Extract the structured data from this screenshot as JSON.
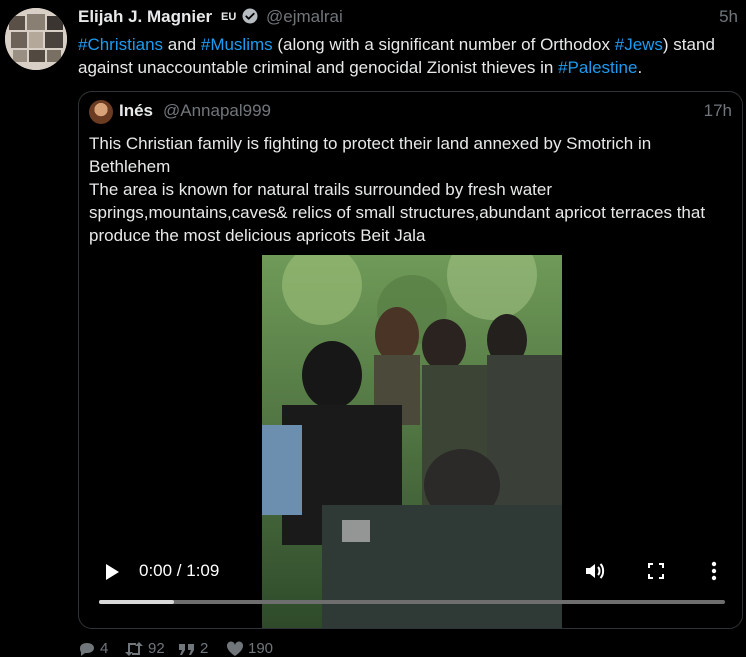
{
  "author": {
    "name": "Elijah J. Magnier",
    "badge": "EU",
    "handle": "@ejmalrai",
    "time": "5h"
  },
  "tweet": {
    "parts": [
      {
        "text": "#Christians",
        "hashtag": true
      },
      {
        "text": " and ",
        "hashtag": false
      },
      {
        "text": "#Muslims",
        "hashtag": true
      },
      {
        "text": " (along with a significant number of Orthodox ",
        "hashtag": false
      },
      {
        "text": "#Jews",
        "hashtag": true
      },
      {
        "text": ") stand against unaccountable criminal and genocidal Zionist thieves in ",
        "hashtag": false
      },
      {
        "text": "#Palestine",
        "hashtag": true
      },
      {
        "text": ".",
        "hashtag": false
      }
    ]
  },
  "quoted": {
    "name": "Inés",
    "handle": "@Annapal999",
    "time": "17h",
    "line1": "This Christian family is fighting to protect their land annexed by Smotrich in Bethlehem",
    "line2": "The area is known for natural trails surrounded by fresh water springs,mountains,caves& relics of small structures,abundant apricot terraces that produce the most delicious apricots Beit Jala"
  },
  "video": {
    "time_display": "0:00 / 1:09",
    "progress": 0.12
  },
  "actions": {
    "replies": "4",
    "retweets": "92",
    "quotes": "2",
    "likes": "190"
  },
  "colors": {
    "accent": "#1d9bf0",
    "muted": "#71767b",
    "border": "#2f3336"
  }
}
